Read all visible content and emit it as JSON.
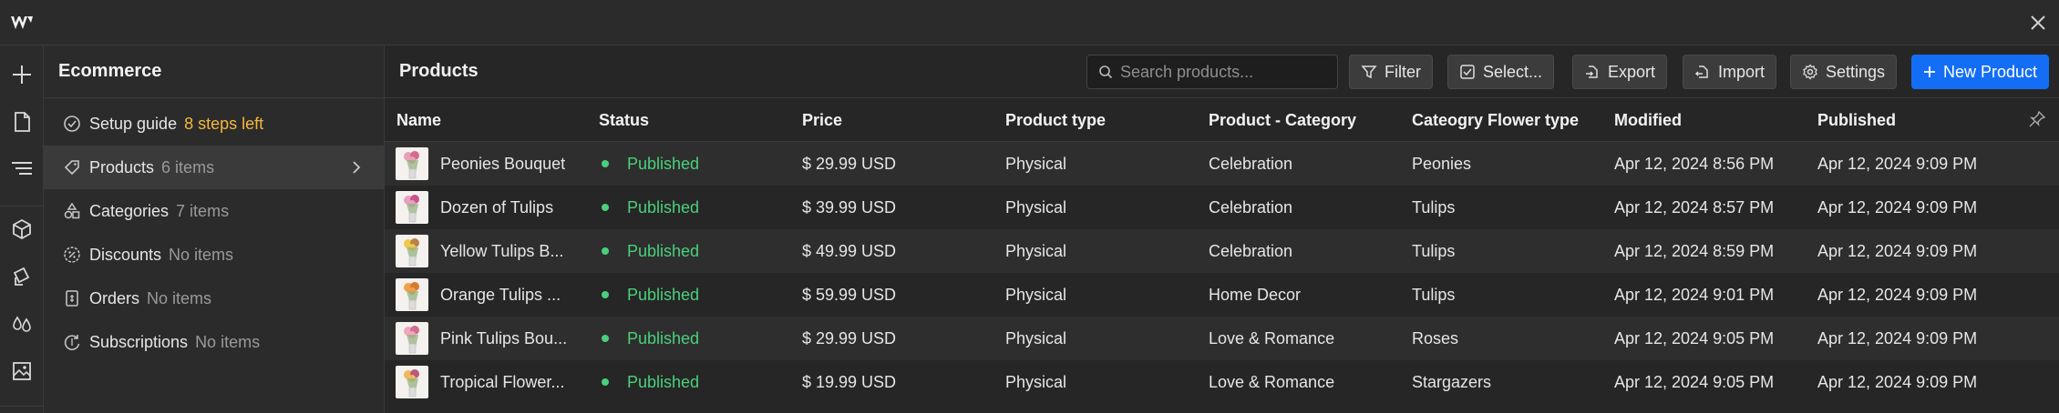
{
  "colors": {
    "accent": "#146ef5",
    "published": "#4ad07b",
    "warning": "#f5b73c"
  },
  "topbar": {
    "logo_icon": "webflow-logo-icon",
    "close_icon": "close-icon"
  },
  "rail": {
    "items": [
      {
        "icon": "add-icon"
      },
      {
        "icon": "page-icon"
      },
      {
        "icon": "navigator-icon"
      },
      {
        "icon": "components-icon"
      },
      {
        "icon": "cms-icon"
      },
      {
        "icon": "styles-icon"
      },
      {
        "icon": "assets-icon"
      }
    ]
  },
  "sidebar": {
    "title": "Ecommerce",
    "items": [
      {
        "label": "Setup guide",
        "count": "8 steps left",
        "icon": "check-circle-icon"
      },
      {
        "label": "Products",
        "count": "6 items",
        "icon": "tag-icon"
      },
      {
        "label": "Categories",
        "count": "7 items",
        "icon": "shapes-icon"
      },
      {
        "label": "Discounts",
        "count": "No items",
        "icon": "discount-icon"
      },
      {
        "label": "Orders",
        "count": "No items",
        "icon": "receipt-icon"
      },
      {
        "label": "Subscriptions",
        "count": "No items",
        "icon": "subscription-icon"
      }
    ]
  },
  "main": {
    "title": "Products",
    "search_placeholder": "Search products...",
    "toolbar": {
      "filter": "Filter",
      "select": "Select...",
      "export": "Export",
      "import": "Import",
      "settings": "Settings",
      "new_product": "New Product"
    },
    "columns": [
      "Name",
      "Status",
      "Price",
      "Product type",
      "Product - Category",
      "Cateogry Flower type",
      "Modified",
      "Published"
    ],
    "rows": [
      {
        "name": "Peonies Bouquet",
        "status": "Published",
        "price": "$ 29.99 USD",
        "type": "Physical",
        "category": "Celebration",
        "flower": "Peonies",
        "modified": "Apr 12, 2024 8:56 PM",
        "published": "Apr 12, 2024 9:09 PM"
      },
      {
        "name": "Dozen of Tulips",
        "status": "Published",
        "price": "$ 39.99 USD",
        "type": "Physical",
        "category": "Celebration",
        "flower": "Tulips",
        "modified": "Apr 12, 2024 8:57 PM",
        "published": "Apr 12, 2024 9:09 PM"
      },
      {
        "name": "Yellow Tulips B...",
        "status": "Published",
        "price": "$ 49.99 USD",
        "type": "Physical",
        "category": "Celebration",
        "flower": "Tulips",
        "modified": "Apr 12, 2024 8:59 PM",
        "published": "Apr 12, 2024 9:09 PM"
      },
      {
        "name": "Orange Tulips ...",
        "status": "Published",
        "price": "$ 59.99 USD",
        "type": "Physical",
        "category": "Home Decor",
        "flower": "Tulips",
        "modified": "Apr 12, 2024 9:01 PM",
        "published": "Apr 12, 2024 9:09 PM"
      },
      {
        "name": "Pink Tulips Bou...",
        "status": "Published",
        "price": "$ 29.99 USD",
        "type": "Physical",
        "category": "Love & Romance",
        "flower": "Roses",
        "modified": "Apr 12, 2024 9:05 PM",
        "published": "Apr 12, 2024 9:09 PM"
      },
      {
        "name": "Tropical Flower...",
        "status": "Published",
        "price": "$ 19.99 USD",
        "type": "Physical",
        "category": "Love & Romance",
        "flower": "Stargazers",
        "modified": "Apr 12, 2024 9:05 PM",
        "published": "Apr 12, 2024 9:09 PM"
      }
    ]
  }
}
